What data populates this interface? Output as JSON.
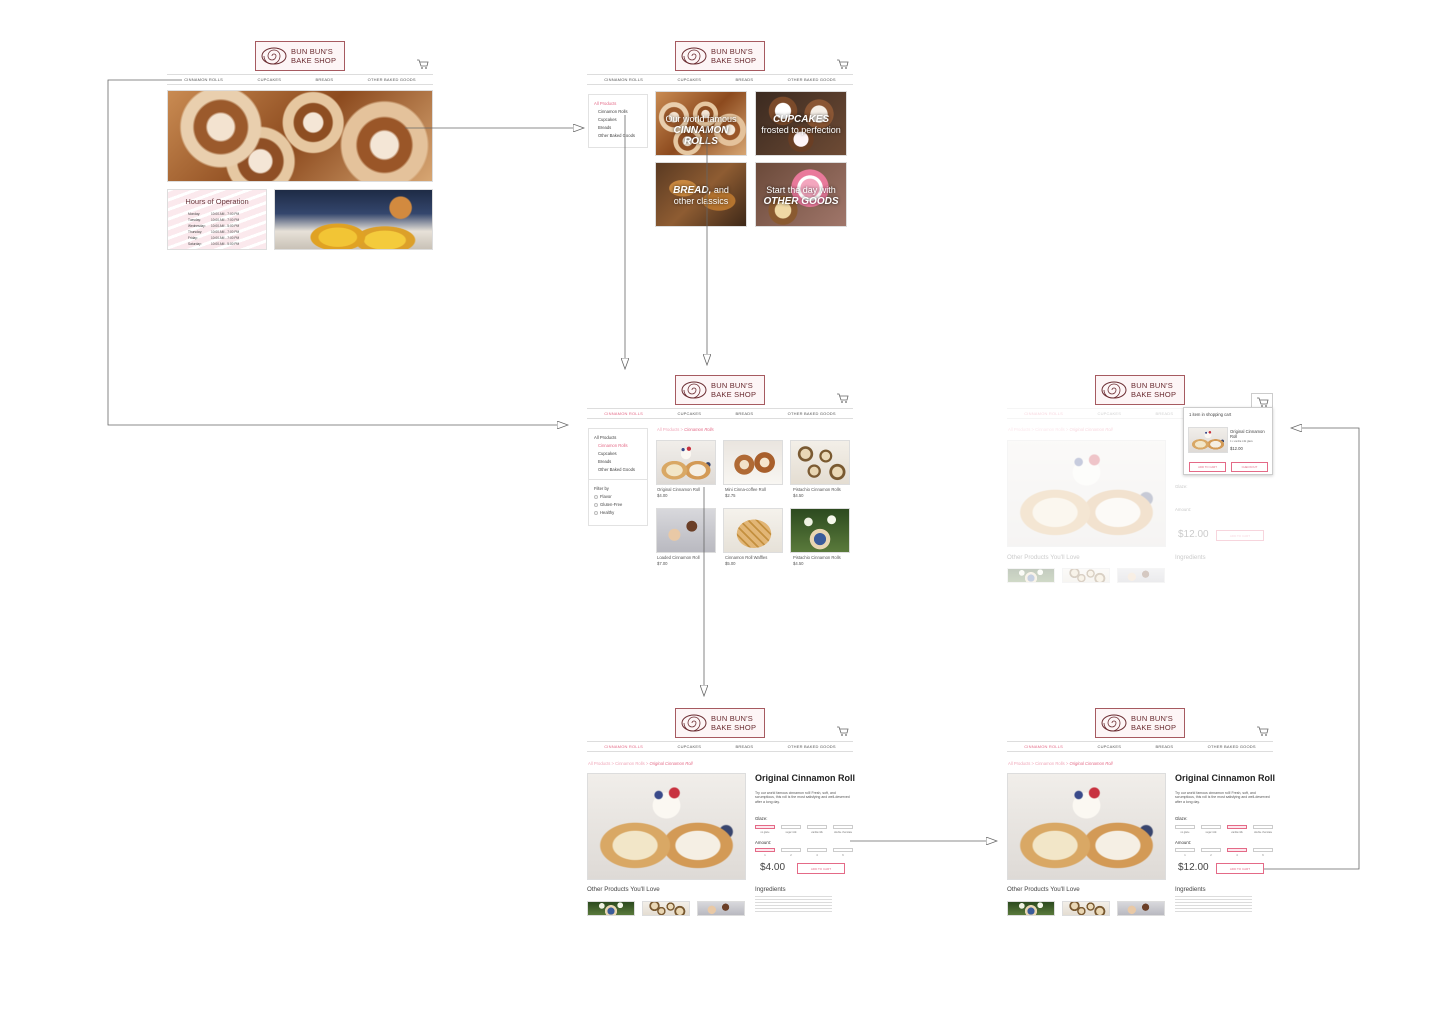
{
  "brand": {
    "line1": "BUN BUN'S",
    "line2": "BAKE SHOP"
  },
  "nav": [
    "CINNAMON ROLLS",
    "CUPCAKES",
    "BREADS",
    "OTHER BAKED GOODS"
  ],
  "hours": {
    "title": "Hours of Operation",
    "rows": [
      {
        "day": "Monday:",
        "time": "10:00 AM - 7:00 PM"
      },
      {
        "day": "Tuesday:",
        "time": "10:00 AM - 7:00 PM"
      },
      {
        "day": "Wednesday:",
        "time": "10:00 AM - 5:00 PM"
      },
      {
        "day": "Thursday:",
        "time": "10:00 AM - 7:00 PM"
      },
      {
        "day": "Friday:",
        "time": "10:00 AM - 7:00 PM"
      },
      {
        "day": "Saturday:",
        "time": "10:00 AM - 5:00 PM"
      }
    ]
  },
  "sidebar": {
    "all": "All Products",
    "items": [
      "Cinnamon Rolls",
      "Cupcakes",
      "Breads",
      "Other Baked Goods"
    ],
    "filter_title": "Filter by",
    "filters": [
      "Flavor",
      "Gluten-Free",
      "Healthy"
    ]
  },
  "categories": {
    "rolls": {
      "line1": "Our world famous",
      "line2": "CINNAMON ROLLS"
    },
    "cupcakes": {
      "line1": "CUPCAKES",
      "line2": "frosted to perfection"
    },
    "bread": {
      "bold": "BREAD,",
      "rest": " and",
      "line2": "other classics"
    },
    "other": {
      "line1": "Start the day with",
      "line2": "OTHER GOODS"
    }
  },
  "crumb": {
    "all": "All Products",
    "sep": " > ",
    "cat": "Cinnamon Rolls",
    "item": "Original Cinnamon Roll"
  },
  "products": [
    {
      "name": "Original Cinnamon Roll",
      "price": "$4.00"
    },
    {
      "name": "Mini Cinna-coffee Roll",
      "price": "$2.75"
    },
    {
      "name": "Pistachio Cinnamon Rolls",
      "price": "$4.50"
    },
    {
      "name": "Loaded Cinnamon Roll",
      "price": "$7.00"
    },
    {
      "name": "Cinnamon Roll Waffles",
      "price": "$5.00"
    },
    {
      "name": "Pistachio Cinnamon Rolls",
      "price": "$4.50"
    }
  ],
  "detail": {
    "title": "Original Cinnamon Roll",
    "desc": "Try our world famous cinnamon roll! Fresh, soft, and scrumptious, this roll is the most satisfying and well-deserved after a long day.",
    "glaze_label": "Glaze:",
    "glazes": [
      "no glaze",
      "sugar milk",
      "vanilla milk",
      "double chocolate"
    ],
    "amount_label": "Amount:",
    "amounts": [
      "1",
      "2",
      "4",
      "6"
    ],
    "price_a": "$4.00",
    "price_b": "$12.00",
    "add": "ADD TO CART",
    "other": "Other Products You'll Love",
    "ingredients": "Ingredients"
  },
  "cart_popup": {
    "title": "1 item in shopping cart",
    "item": "Original Cinnamon Roll",
    "sub": "4 x vanilla milk glaze",
    "price": "$12.00",
    "add": "ADD TO CART",
    "checkout": "CHECKOUT"
  },
  "colors": {
    "accent": "#e46a87",
    "brand": "#a65a60"
  }
}
